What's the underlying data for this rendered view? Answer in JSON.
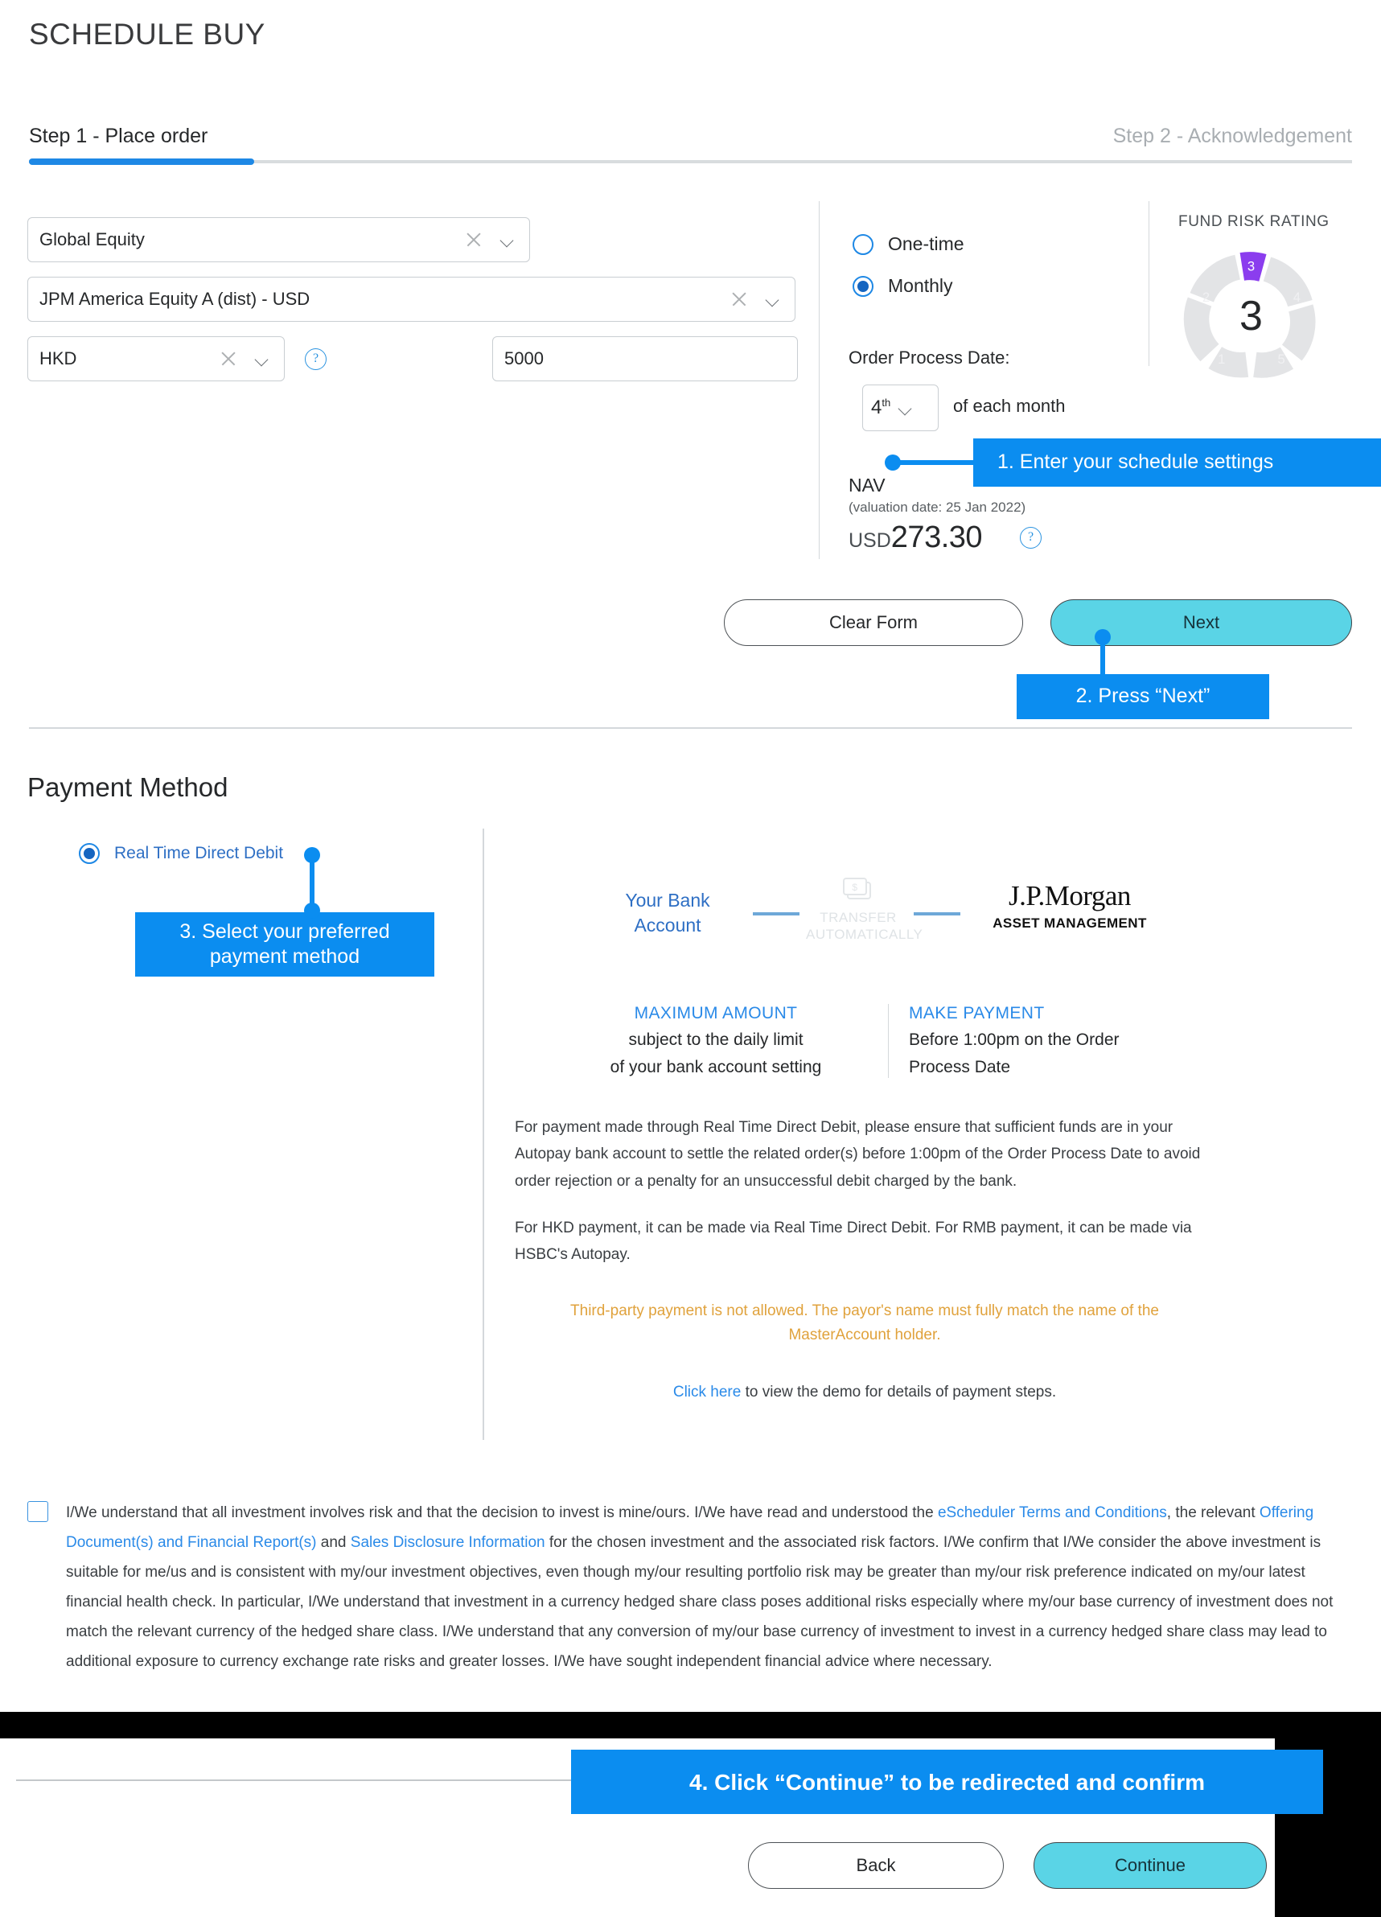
{
  "header": {
    "title": "SCHEDULE BUY"
  },
  "steps": {
    "step1": "Step 1 - Place order",
    "step2": "Step 2 - Acknowledgement"
  },
  "order_form": {
    "category": {
      "value": "Global Equity",
      "clear_icon": "close-icon",
      "dropdown_icon": "chevron-down-icon"
    },
    "fund": {
      "value": "JPM America Equity A (dist) - USD"
    },
    "currency": {
      "value": "HKD",
      "help_icon": "help-circle-icon"
    },
    "amount": {
      "value": "5000"
    }
  },
  "schedule": {
    "frequency_options": [
      {
        "label": "One-time",
        "selected": false
      },
      {
        "label": "Monthly",
        "selected": true
      }
    ],
    "order_process_date_label": "Order Process Date:",
    "day": "4",
    "day_suffix": "th",
    "of_each_month": "of each month"
  },
  "nav": {
    "label": "NAV",
    "valuation_date": "(valuation date: 25 Jan 2022)",
    "currency": "USD",
    "amount": "273.30",
    "help_icon": "help-circle-icon"
  },
  "fund_risk_rating": {
    "title": "FUND RISK RATING",
    "value": "3",
    "segments": [
      "1",
      "2",
      "3",
      "4",
      "5"
    ],
    "active_segment": "3",
    "active_color": "#8b3dee",
    "inactive_color": "#e3e4e6"
  },
  "step1_buttons": {
    "clear": "Clear Form",
    "next": "Next"
  },
  "payment_method": {
    "section_title": "Payment Method",
    "options": [
      {
        "label": "Real Time Direct Debit",
        "selected": true
      }
    ],
    "flow": {
      "source": "Your Bank\nAccount",
      "source_line1": "Your Bank",
      "source_line2": "Account",
      "middle_line1": "TRANSFER",
      "middle_line2": "AUTOMATICALLY",
      "middle_icon": "banknotes-icon",
      "destination_line1": "J.P.Morgan",
      "destination_line2": "ASSET MANAGEMENT"
    },
    "details": [
      {
        "heading": "MAXIMUM AMOUNT",
        "body": "subject to the daily limit\nof your bank account setting"
      },
      {
        "heading": "MAKE PAYMENT",
        "body": "Before 1:00pm on the Order\nProcess Date"
      }
    ],
    "paragraph_1": "For payment made through Real Time Direct Debit, please ensure that sufficient funds are in your Autopay bank account to settle the related order(s) before 1:00pm of the Order Process Date to avoid order rejection or a penalty for an unsuccessful debit charged by the bank.",
    "paragraph_2": "For HKD payment, it can be made via Real Time Direct Debit. For RMB payment, it can be made via HSBC's Autopay.",
    "warning": "Third-party payment is not allowed. The payor's name must fully match the name of the MasterAccount holder.",
    "demo_link_text": "Click here",
    "demo_rest": " to view the demo for details of payment steps."
  },
  "disclaimer": {
    "checked": false,
    "parts": [
      {
        "t": "I/We understand that all investment involves risk and that the decision to invest is mine/ours. I/We have read and understood the ",
        "link": false
      },
      {
        "t": "eScheduler Terms and Conditions",
        "link": true
      },
      {
        "t": ", the relevant ",
        "link": false
      },
      {
        "t": "Offering Document(s) and Financial Report(s)",
        "link": true
      },
      {
        "t": " and ",
        "link": false
      },
      {
        "t": "Sales Disclosure Information",
        "link": true
      },
      {
        "t": " for the chosen investment and the associated risk factors. I/We confirm that I/We consider the above investment is suitable for me/us and is consistent with my/our investment objectives, even though my/our resulting portfolio risk may be greater than my/our risk preference indicated on my/our latest financial health check. In particular, I/We understand that investment in a currency hedged share class poses additional risks especially where my/our base currency of investment does not match the relevant currency of the hedged share class. I/We understand that any conversion of my/our base currency of investment to invest in a currency hedged share class may lead to additional exposure to currency exchange rate risks and greater losses. I/We have sought independent financial advice where necessary.",
        "link": false
      }
    ]
  },
  "bottom_buttons": {
    "back": "Back",
    "continue": "Continue"
  },
  "callouts": [
    {
      "id": 1,
      "text": "1.  Enter your schedule settings"
    },
    {
      "id": 2,
      "text": "2. Press “Next”"
    },
    {
      "id": 3,
      "text": "3. Select your preferred payment method"
    },
    {
      "id": 4,
      "text": "4. Click “Continue” to be redirected and confirm"
    }
  ],
  "colors": {
    "accent_blue": "#0b8df0",
    "progress_blue": "#1e88e5",
    "cta_cyan": "#5ad4e6",
    "risk_purple": "#8b3dee",
    "warning_orange": "#e0a23c",
    "link_blue": "#2a8ae8"
  }
}
